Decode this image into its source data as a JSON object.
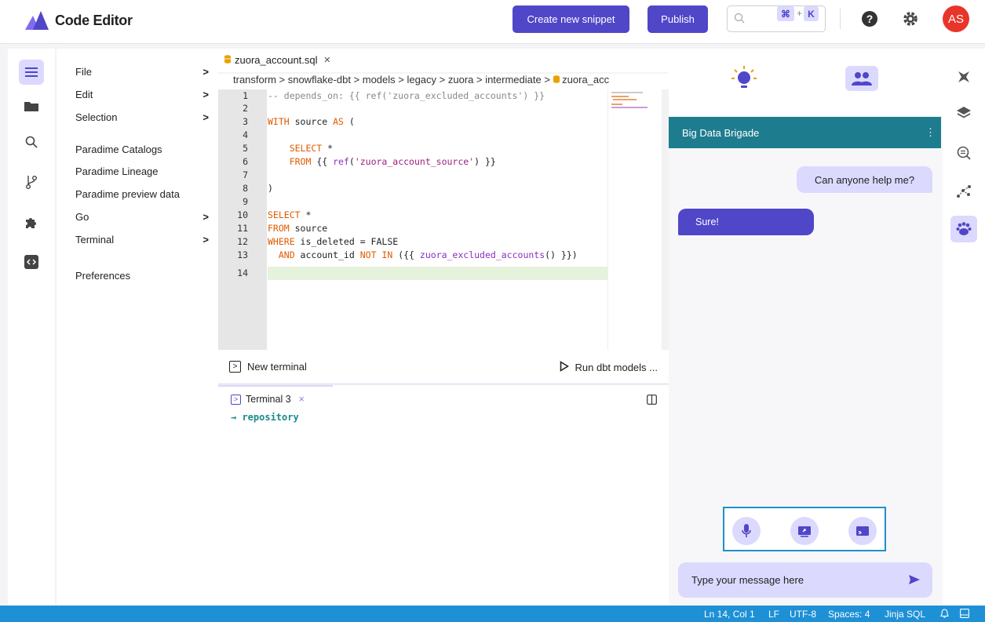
{
  "header": {
    "app_title": "Code Editor",
    "create_snippet_label": "Create new snippet",
    "publish_label": "Publish",
    "search_shortcut_key1": "⌘",
    "search_shortcut_plus": "+",
    "search_shortcut_key2": "K",
    "avatar_initials": "AS"
  },
  "menu": {
    "items": [
      {
        "label": "File",
        "chevron": ">"
      },
      {
        "label": "Edit",
        "chevron": ">"
      },
      {
        "label": "Selection",
        "chevron": ">"
      },
      {
        "label": "Paradime Catalogs",
        "chevron": ""
      },
      {
        "label": "Paradime Lineage",
        "chevron": ""
      },
      {
        "label": "Paradime preview data",
        "chevron": ""
      },
      {
        "label": "Go",
        "chevron": ">"
      },
      {
        "label": "Terminal",
        "chevron": ">"
      },
      {
        "label": "Preferences",
        "chevron": ""
      }
    ]
  },
  "editor": {
    "tab_name": "zuora_account.sql",
    "tab_close": "×",
    "breadcrumb": "transform  >  snowflake-dbt  >  models  >  legacy  >  zuora  >  intermediate  >  ",
    "breadcrumb_file": "zuora_acc",
    "line_numbers": [
      "1",
      "2",
      "3",
      "4",
      "5",
      "6",
      "7",
      "8",
      "9",
      "10",
      "11",
      "12",
      "13",
      "14"
    ]
  },
  "terminal": {
    "new_terminal_label": "New terminal",
    "run_label": "Run dbt models ...",
    "tab_label": "Terminal 3",
    "tab_close": "×",
    "prompt_text": "→ repository"
  },
  "chat": {
    "channel_name": "Big Data Brigade",
    "menu_glyph": "⋮",
    "messages": [
      {
        "from": "self",
        "text": "Can anyone help me?"
      },
      {
        "from": "other",
        "text": "Sure!"
      }
    ],
    "input_placeholder": "Type your message here"
  },
  "statusbar": {
    "position": "Ln 14, Col 1",
    "eol": "LF",
    "encoding": "UTF-8",
    "indent": "Spaces: 4",
    "language": "Jinja SQL"
  },
  "colors": {
    "accent": "#5046c8",
    "accent_light": "#dcd9ff",
    "chat_header": "#1e7c8f",
    "statusbar": "#1e90d6",
    "avatar": "#e8352a"
  }
}
